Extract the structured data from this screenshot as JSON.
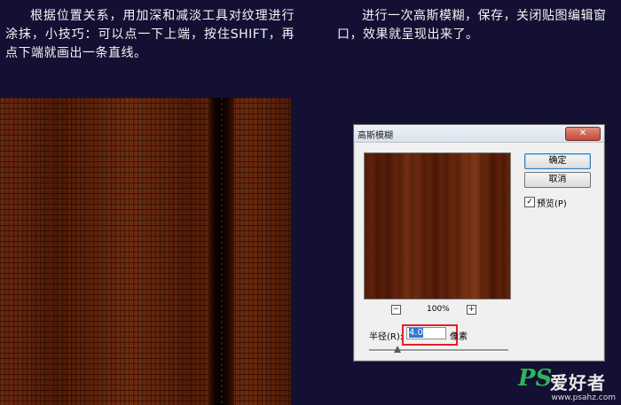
{
  "instructions": {
    "left": "根据位置关系，用加深和减淡工具对纹理进行涂抹，小技巧：可以点一下上端，按住SHIFT，再点下端就画出一条直线。",
    "right": "进行一次高斯模糊，保存，关闭贴图编辑窗口，效果就呈现出来了。"
  },
  "dialog": {
    "title": "高斯模糊",
    "close_icon": "close-icon",
    "ok_label": "确定",
    "cancel_label": "取消",
    "preview_checkbox_label": "预览(P)",
    "preview_checked": true,
    "zoom_out_label": "−",
    "zoom_in_label": "+",
    "zoom_level": "100%",
    "radius_label": "半径(R):",
    "radius_value": "4.0",
    "unit_label": "像素"
  },
  "watermark": {
    "ps": "PS",
    "cn": "爱好者",
    "url": "www.psahz.com"
  },
  "colors": {
    "background": "#131033",
    "wood": "#5a1f0a",
    "highlight_box": "#e0212b"
  }
}
